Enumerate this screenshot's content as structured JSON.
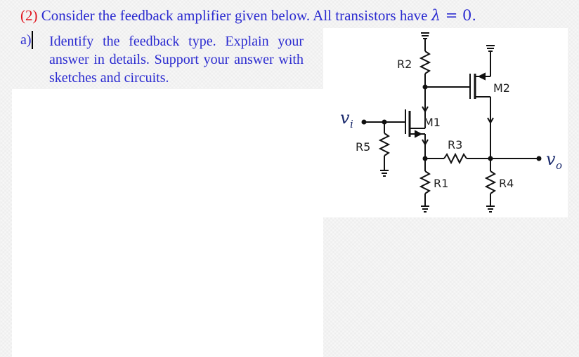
{
  "question": {
    "number": "(2)",
    "text": " Consider the feedback amplifier given below. All transistors have ",
    "lambda_symbol": "λ",
    "equation_rest": " = 0.",
    "number_color": "#e0141e",
    "text_color": "#2b2bd0"
  },
  "part_a": {
    "label": "a)",
    "text": "Identify the feedback type. Explain your answer in details. Support your answer with sketches and circuits."
  },
  "circuit": {
    "components": {
      "R1": "R1",
      "R2": "R2",
      "R3": "R3",
      "R4": "R4",
      "R5": "R5",
      "M1": "M1",
      "M2": "M2"
    },
    "input_label": "v",
    "input_sub": "i",
    "output_label": "v",
    "output_sub": "o"
  }
}
